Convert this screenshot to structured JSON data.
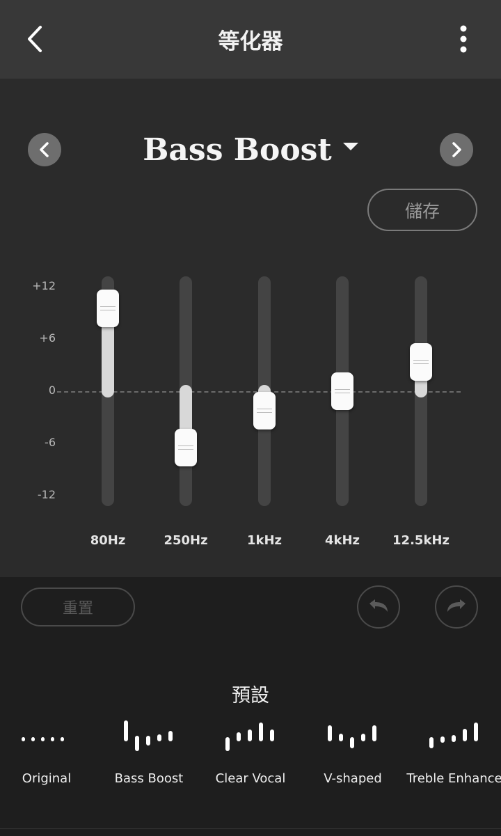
{
  "header": {
    "title": "等化器"
  },
  "preset": {
    "current": "Bass Boost",
    "save_label": "儲存"
  },
  "scale": {
    "labels": [
      "+12",
      "+6",
      "0",
      "-6",
      "-12"
    ],
    "min_db": -12,
    "max_db": 12
  },
  "bands": [
    {
      "label": "80Hz",
      "gain_db": 9.5
    },
    {
      "label": "250Hz",
      "gain_db": -6.5
    },
    {
      "label": "1kHz",
      "gain_db": -2.2
    },
    {
      "label": "4kHz",
      "gain_db": 0
    },
    {
      "label": "12.5kHz",
      "gain_db": 3.4
    }
  ],
  "controls": {
    "reset_label": "重置"
  },
  "presets": {
    "heading": "預設",
    "items": [
      {
        "label": "Original"
      },
      {
        "label": "Bass Boost"
      },
      {
        "label": "Clear Vocal"
      },
      {
        "label": "V-shaped"
      },
      {
        "label": "Treble Enhance"
      }
    ]
  },
  "icons": {
    "back": "chevron-left-icon",
    "more": "more-vertical-icon",
    "prev": "chevron-left-icon",
    "next": "chevron-right-icon",
    "undo": "undo-icon",
    "redo": "redo-icon"
  },
  "colors": {
    "header_bg": "#383838",
    "panel_bg": "#2b2b2b",
    "page_bg": "#1e1e1e",
    "track": "#444444",
    "fill": "#d8d8d8",
    "thumb": "#fbfbfb"
  }
}
